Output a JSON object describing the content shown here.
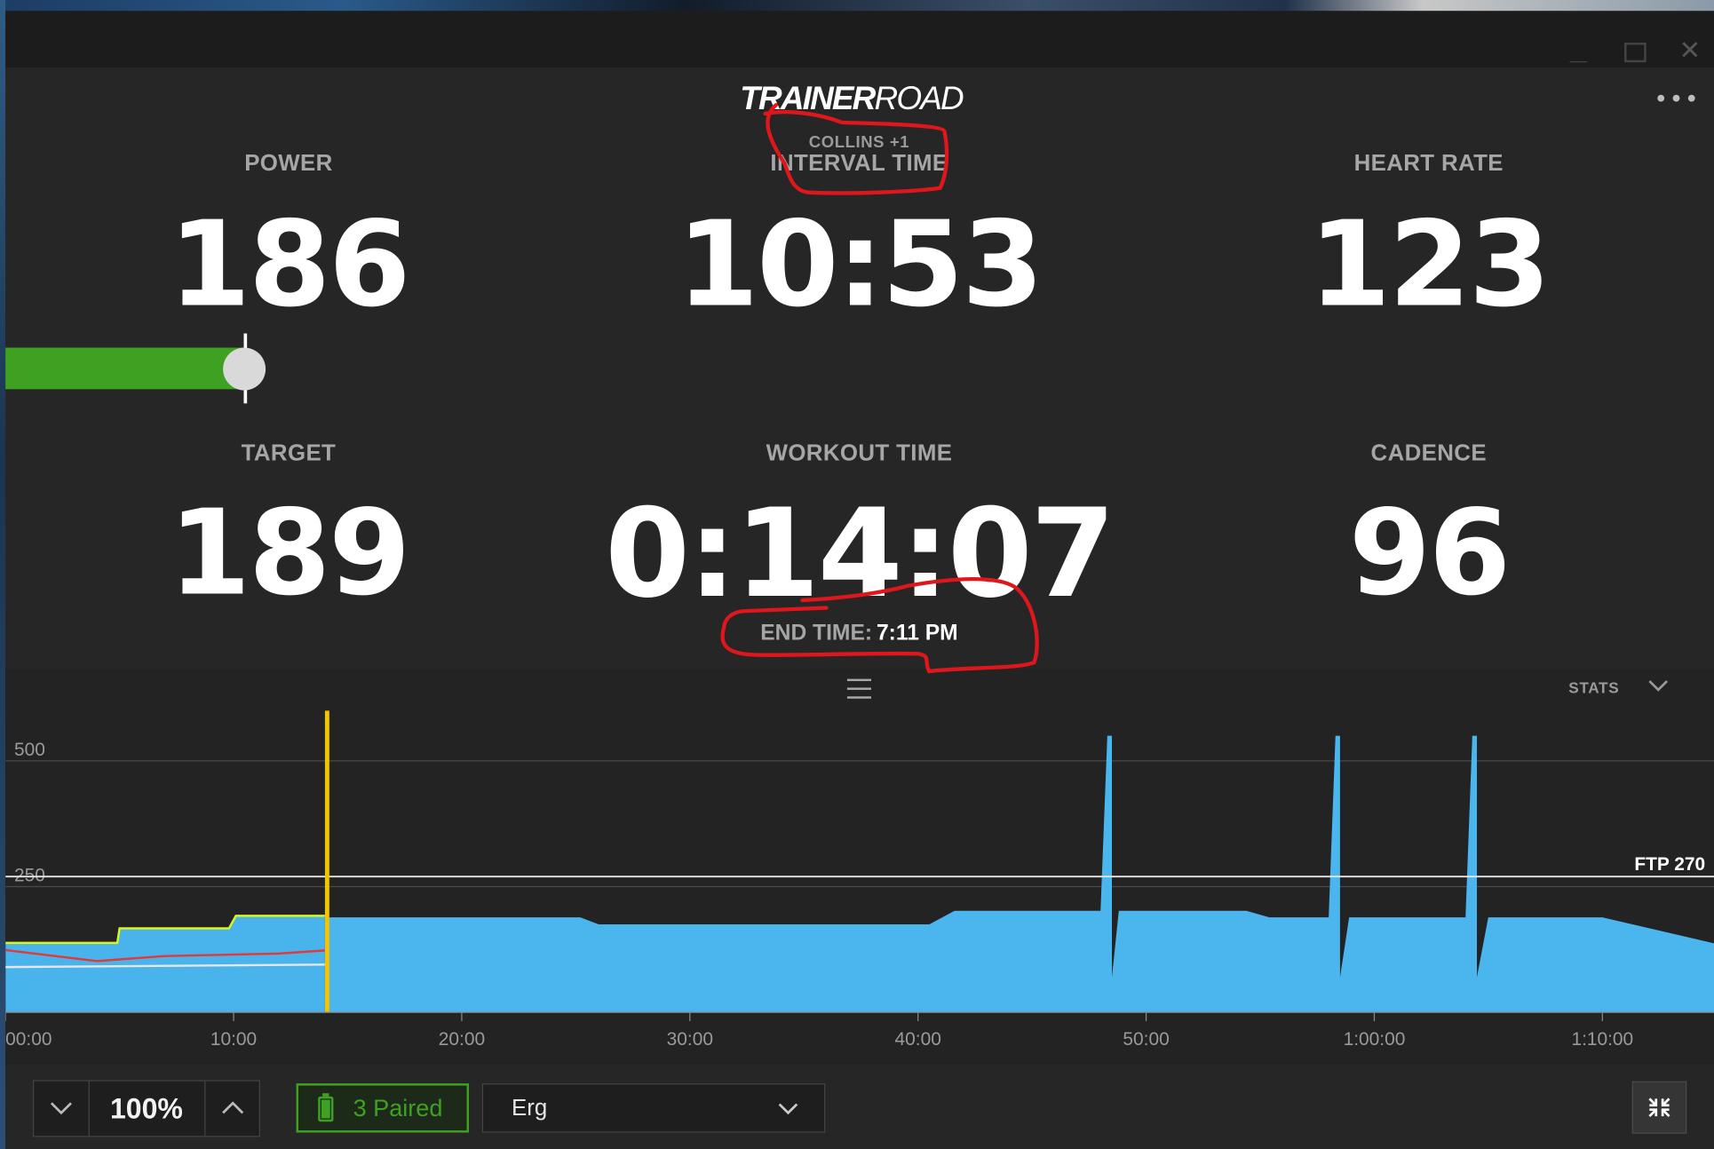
{
  "app": {
    "logo_bold": "TRAINER",
    "logo_light": "ROAD",
    "rider": "COLLINS +1"
  },
  "metrics": {
    "power": {
      "label": "POWER",
      "value": "186"
    },
    "interval_time": {
      "label": "INTERVAL TIME",
      "value": "10:53"
    },
    "heart_rate": {
      "label": "HEART RATE",
      "value": "123"
    },
    "target": {
      "label": "TARGET",
      "value": "189"
    },
    "workout_time": {
      "label": "WORKOUT TIME",
      "value": "0:14:07"
    },
    "cadence": {
      "label": "CADENCE",
      "value": "96"
    },
    "end_time": {
      "label": "END TIME:",
      "value": "7:11 PM"
    }
  },
  "chart": {
    "stats_label": "STATS",
    "ftp_label": "FTP 270",
    "y_ticks": [
      "500",
      "250"
    ],
    "x_ticks": [
      "00:00",
      "10:00",
      "20:00",
      "30:00",
      "40:00",
      "50:00",
      "1:00:00",
      "1:10:00"
    ]
  },
  "chart_data": {
    "type": "area",
    "y_range": [
      0,
      600
    ],
    "x_range_minutes": [
      0,
      75
    ],
    "ftp": 270,
    "current_position_minutes": 14.1,
    "workout_profile_watts": [
      [
        14,
        189
      ],
      [
        25.2,
        189
      ],
      [
        26,
        175
      ],
      [
        40.5,
        175
      ],
      [
        41.6,
        202
      ],
      [
        48,
        202
      ],
      [
        48.3,
        550
      ],
      [
        48.5,
        550
      ],
      [
        48.5,
        70
      ],
      [
        48.8,
        202
      ],
      [
        54.4,
        202
      ],
      [
        55.4,
        189
      ],
      [
        58,
        189
      ],
      [
        58.3,
        550
      ],
      [
        58.5,
        550
      ],
      [
        58.5,
        70
      ],
      [
        58.9,
        189
      ],
      [
        64,
        189
      ],
      [
        64.3,
        550
      ],
      [
        64.5,
        550
      ],
      [
        64.5,
        70
      ],
      [
        65,
        189
      ],
      [
        70,
        189
      ],
      [
        75,
        136
      ]
    ],
    "series": [
      {
        "name": "power",
        "color": "#d7f51e",
        "values": [
          [
            0,
            138
          ],
          [
            4.9,
            138
          ],
          [
            5,
            167
          ],
          [
            9.8,
            167
          ],
          [
            10.1,
            192
          ],
          [
            14,
            192
          ]
        ]
      },
      {
        "name": "heart rate",
        "color": "#e03a3a",
        "values": [
          [
            0,
            124
          ],
          [
            4,
            102
          ],
          [
            7,
            112
          ],
          [
            12,
            117
          ],
          [
            14,
            123
          ]
        ]
      },
      {
        "name": "cadence",
        "color": "#e6e6e6",
        "values": [
          [
            0,
            90
          ],
          [
            14,
            95
          ]
        ]
      }
    ]
  },
  "controls": {
    "intensity": "100%",
    "paired": "3 Paired",
    "mode": "Erg"
  },
  "colors": {
    "accent_green": "#3fa122",
    "workout_blue": "#4bb5ee",
    "position_marker": "#f5c400",
    "annotation_red": "#e0161d"
  }
}
